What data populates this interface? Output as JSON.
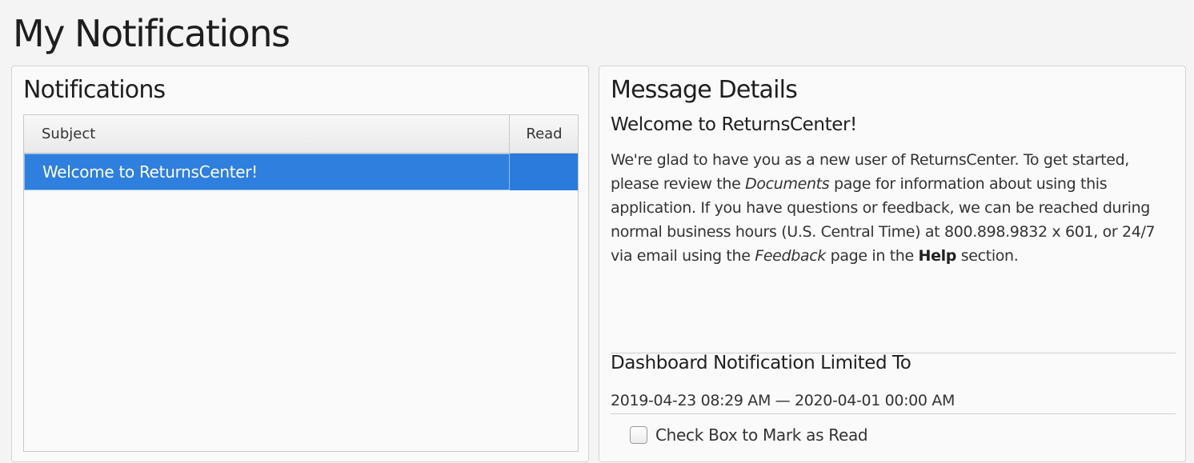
{
  "page": {
    "title": "My Notifications"
  },
  "notifications": {
    "heading": "Notifications",
    "columns": {
      "subject": "Subject",
      "read": "Read"
    },
    "rows": [
      {
        "subject": "Welcome to ReturnsCenter!",
        "read": ""
      }
    ]
  },
  "details": {
    "heading": "Message Details",
    "subject": "Welcome to ReturnsCenter!",
    "body": {
      "p1": "We're glad to have you as a new user of ReturnsCenter.  To get started, please review the ",
      "documents": "Documents",
      "p2": " page for information about using this application.  If you have questions or feedback, we can be reached during normal business hours (U.S. Central Time) at 800.898.9832 x 601, or 24/7 via email using the ",
      "feedback": "Feedback",
      "p3": " page in the ",
      "help": "Help",
      "p4": " section."
    },
    "limited_label": "Dashboard Notification Limited To",
    "date_range": "2019-04-23 08:29 AM — 2020-04-01 00:00 AM",
    "mark_read_label": "Check Box to Mark as Read",
    "mark_read_checked": false
  },
  "colors": {
    "selected_row": "#2a7bdc",
    "background": "#f4f4f4",
    "panel": "#fafafa"
  }
}
